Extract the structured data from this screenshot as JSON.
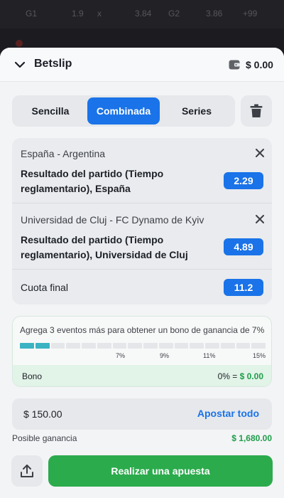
{
  "background": {
    "odds_row": [
      "G1",
      "1.9",
      "x",
      "3.84",
      "G2",
      "3.86",
      "+99"
    ]
  },
  "header": {
    "title": "Betslip",
    "balance": "$ 0.00",
    "wallet_icon": "wallet-icon",
    "chevron_icon": "chevron-down-icon"
  },
  "tabs": [
    {
      "label": "Sencilla",
      "active": false
    },
    {
      "label": "Combinada",
      "active": true
    },
    {
      "label": "Series",
      "active": false
    }
  ],
  "bets": [
    {
      "match": "España - Argentina",
      "selection": "Resultado del partido (Tiempo reglamentario), España",
      "odds": "2.29"
    },
    {
      "match": "Universidad de Cluj - FC Dynamo de Kyiv",
      "selection": "Resultado del partido (Tiempo reglamentario), Universidad de Cluj",
      "odds": "4.89"
    }
  ],
  "final": {
    "label": "Cuota final",
    "odds": "11.2"
  },
  "bonus": {
    "message": "Agrega 3 eventos más para obtener un bono de ganancia de 7%",
    "progress_filled_segments": 2,
    "total_segments": 16,
    "tiers": [
      "7%",
      "9%",
      "11%",
      "15%"
    ],
    "label": "Bono",
    "percent": "0% =",
    "amount": "$ 0.00"
  },
  "stake": {
    "value": "$ 150.00",
    "all_in_label": "Apostar todo"
  },
  "possible_win": {
    "label": "Posible ganancia",
    "value": "$ 1,680.00"
  },
  "actions": {
    "place_bet_label": "Realizar una apuesta"
  },
  "colors": {
    "accent": "#1a73e8",
    "success": "#2bab4c",
    "progress": "#3bb3c3"
  }
}
